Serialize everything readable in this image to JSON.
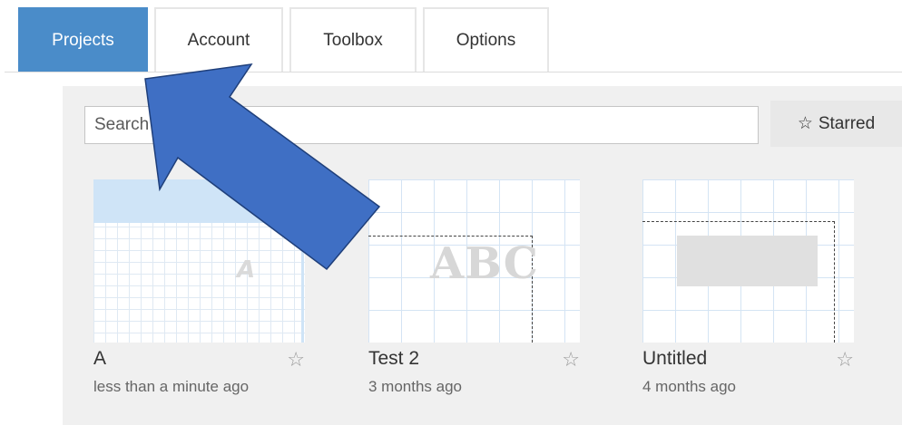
{
  "tabs": [
    {
      "label": "Projects",
      "active": true
    },
    {
      "label": "Account",
      "active": false
    },
    {
      "label": "Toolbox",
      "active": false
    },
    {
      "label": "Options",
      "active": false
    }
  ],
  "search": {
    "placeholder": "Search",
    "value": ""
  },
  "starred_button": {
    "label": "Starred",
    "icon": "star-outline-icon"
  },
  "projects": [
    {
      "name": "A",
      "time": "less than a minute ago",
      "thumb_letter": "A",
      "starred": false
    },
    {
      "name": "Test 2",
      "time": "3 months ago",
      "thumb_text": "ABC",
      "starred": false
    },
    {
      "name": "Untitled",
      "time": "4 months ago",
      "starred": false
    }
  ],
  "colors": {
    "accent": "#4a8cc9",
    "arrow_fill": "#3f6fc4",
    "arrow_stroke": "#1f3f7a"
  }
}
